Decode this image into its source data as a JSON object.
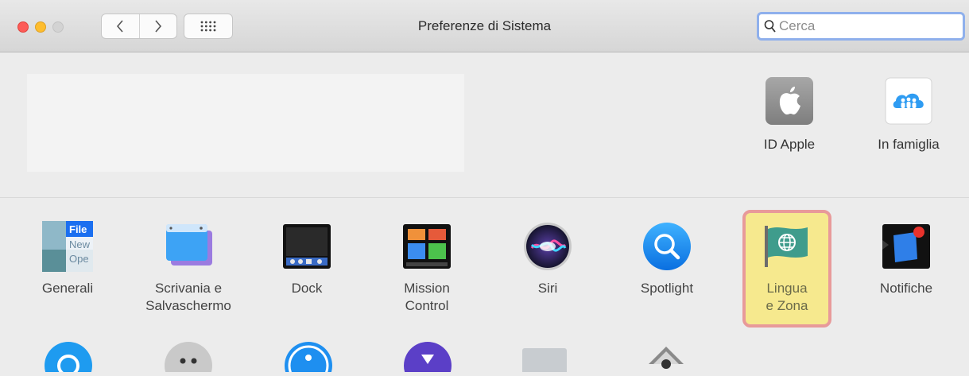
{
  "window": {
    "title": "Preferenze di Sistema"
  },
  "search": {
    "placeholder": "Cerca",
    "value": ""
  },
  "top_items": [
    {
      "label": "ID Apple",
      "icon": "apple-id-icon"
    },
    {
      "label": "In famiglia",
      "icon": "family-sharing-icon"
    }
  ],
  "prefs": [
    {
      "label": "Generali",
      "icon": "general-icon",
      "icon_text": [
        "File",
        "New",
        "Ope"
      ]
    },
    {
      "label": "Scrivania e\nSalvaschermo",
      "icon": "desktop-screensaver-icon"
    },
    {
      "label": "Dock",
      "icon": "dock-icon"
    },
    {
      "label": "Mission\nControl",
      "icon": "mission-control-icon"
    },
    {
      "label": "Siri",
      "icon": "siri-icon"
    },
    {
      "label": "Spotlight",
      "icon": "spotlight-icon"
    },
    {
      "label": "Lingua\ne Zona",
      "icon": "language-region-icon",
      "selected": true
    },
    {
      "label": "Notifiche",
      "icon": "notifications-icon"
    }
  ],
  "colors": {
    "selected_fill": "#f6e98e",
    "selected_border": "#e89a9a",
    "search_focus": "#8fb0ec"
  }
}
